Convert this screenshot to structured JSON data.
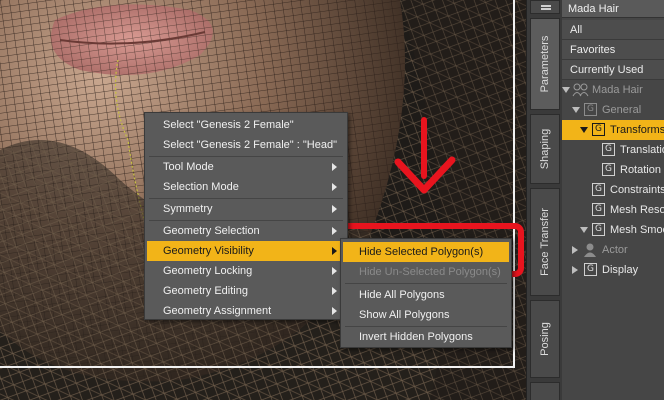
{
  "context_menu": {
    "items": [
      {
        "label": "Select \"Genesis 2 Female\"",
        "submenu": false
      },
      {
        "label": "Select \"Genesis 2 Female\" : \"Head\"",
        "submenu": false
      },
      {
        "label": "Tool Mode",
        "submenu": true
      },
      {
        "label": "Selection Mode",
        "submenu": true
      },
      {
        "label": "Symmetry",
        "submenu": true
      },
      {
        "label": "Geometry Selection",
        "submenu": true
      },
      {
        "label": "Geometry Visibility",
        "submenu": true,
        "highlighted": true
      },
      {
        "label": "Geometry Locking",
        "submenu": true
      },
      {
        "label": "Geometry Editing",
        "submenu": true
      },
      {
        "label": "Geometry Assignment",
        "submenu": true
      }
    ]
  },
  "submenu": {
    "items": [
      {
        "label": "Hide Selected Polygon(s)",
        "highlighted": true
      },
      {
        "label": "Hide Un-Selected Polygon(s)",
        "disabled": true
      },
      {
        "label": "Hide All Polygons"
      },
      {
        "label": "Show All Polygons"
      },
      {
        "label": "Invert Hidden Polygons"
      }
    ]
  },
  "side_tabs": [
    "Parameters",
    "Shaping",
    "Face Transfer",
    "Posing"
  ],
  "panel": {
    "title": "Mada Hair",
    "filters": [
      "All",
      "Favorites",
      "Currently Used"
    ],
    "tree": [
      {
        "label": "Mada Hair",
        "icon": "figure-icon",
        "expanded": true
      },
      {
        "label": "General",
        "icon": "G",
        "expanded": true
      },
      {
        "label": "Transforms",
        "icon": "G",
        "expanded": true,
        "selected": true
      },
      {
        "label": "Translation",
        "icon": "G"
      },
      {
        "label": "Rotation",
        "icon": "G"
      },
      {
        "label": "Constraints",
        "icon": "G"
      },
      {
        "label": "Mesh Resolution",
        "icon": "G"
      },
      {
        "label": "Mesh Smoothing",
        "icon": "G",
        "expanded": true
      },
      {
        "label": "Actor",
        "icon": "actor-icon",
        "collapsed": true
      },
      {
        "label": "Display",
        "icon": "G",
        "collapsed": true
      }
    ]
  },
  "colors": {
    "highlight": "#f2b418",
    "annotation": "#e8141e",
    "menu_bg": "#5a5a5a",
    "panel_bg": "#464646"
  }
}
